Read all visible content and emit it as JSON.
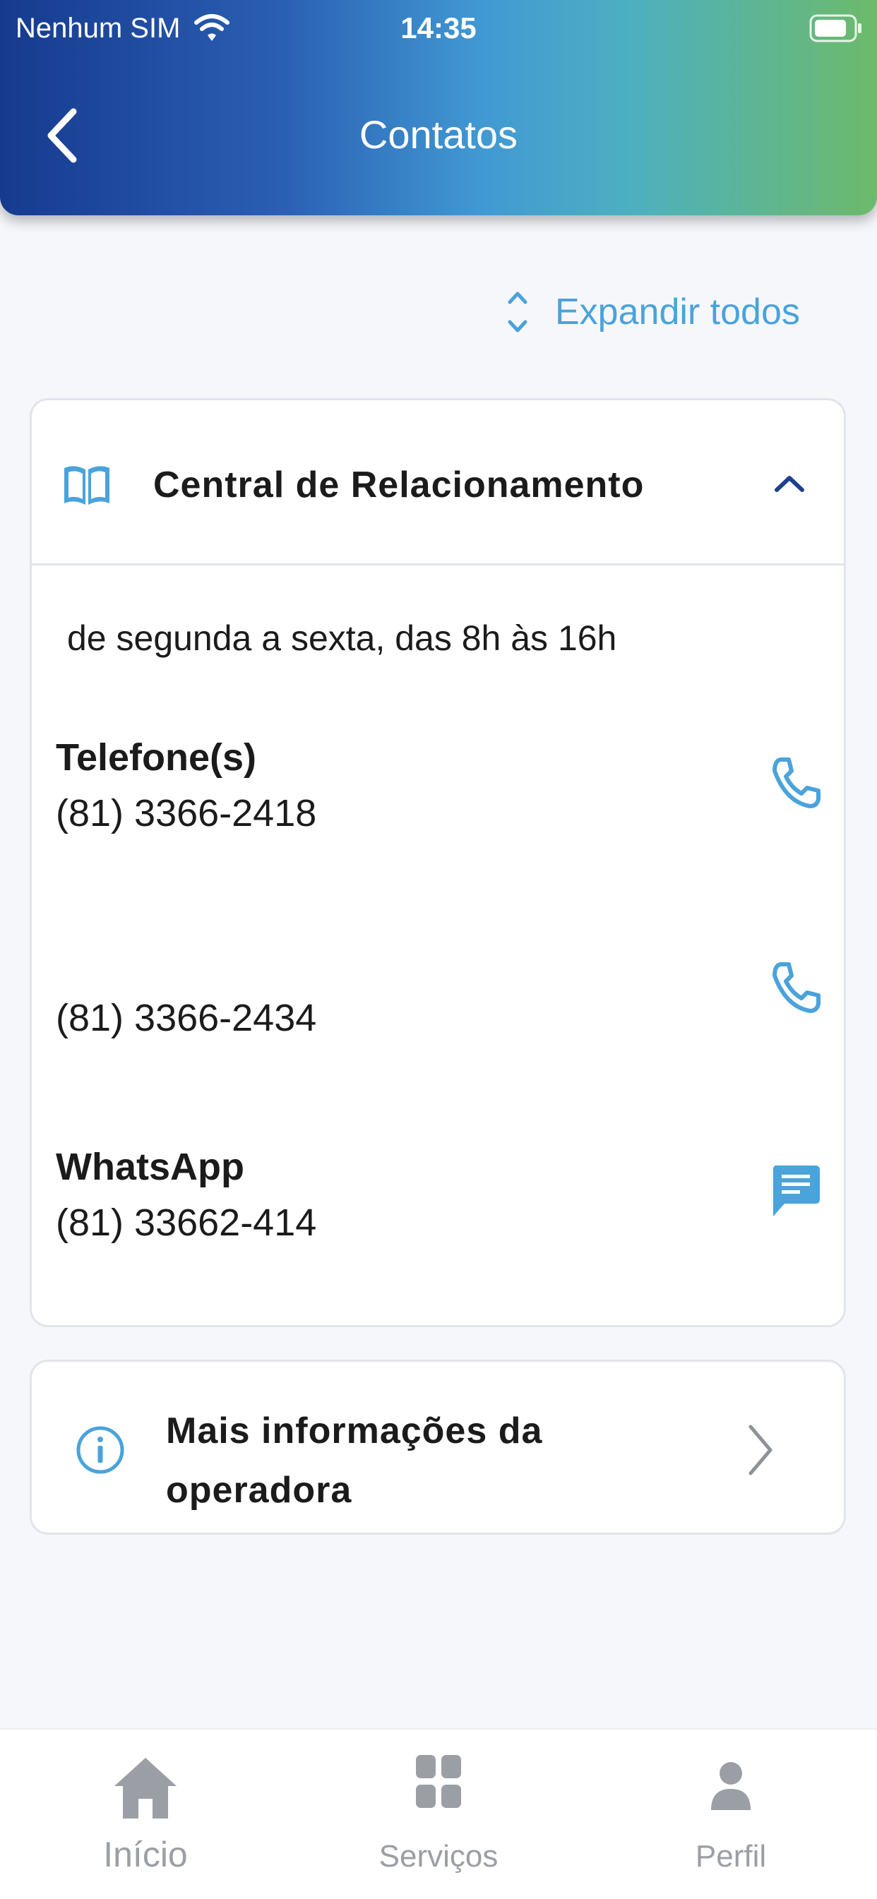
{
  "status_bar": {
    "carrier": "Nenhum SIM",
    "time": "14:35"
  },
  "header": {
    "title": "Contatos",
    "back_icon": "chevron-left-icon"
  },
  "expand_all": {
    "label": "Expandir todos",
    "icon": "expand-vertical-icon"
  },
  "accordion": {
    "title": "Central de Relacionamento",
    "icon": "book-open-icon",
    "state": "expanded",
    "hours": "de segunda a sexta, das 8h às 16h",
    "phones_label": "Telefone(s)",
    "phones": [
      "(81) 3366-2418",
      "(81) 3366-2434"
    ],
    "whatsapp_label": "WhatsApp",
    "whatsapp": "(81) 33662-414"
  },
  "more_info": {
    "title": "Mais informações da operadora",
    "icon": "info-circle-icon"
  },
  "tabbar": {
    "items": [
      {
        "label": "Início",
        "icon": "home-icon"
      },
      {
        "label": "Serviços",
        "icon": "grid-icon"
      },
      {
        "label": "Perfil",
        "icon": "person-icon"
      }
    ]
  },
  "colors": {
    "accent": "#4aa3db",
    "header_gradient_start": "#163a8e",
    "header_gradient_end": "#6dba6a",
    "tab_inactive": "#9b9ea4",
    "text": "#1b1b1b"
  }
}
